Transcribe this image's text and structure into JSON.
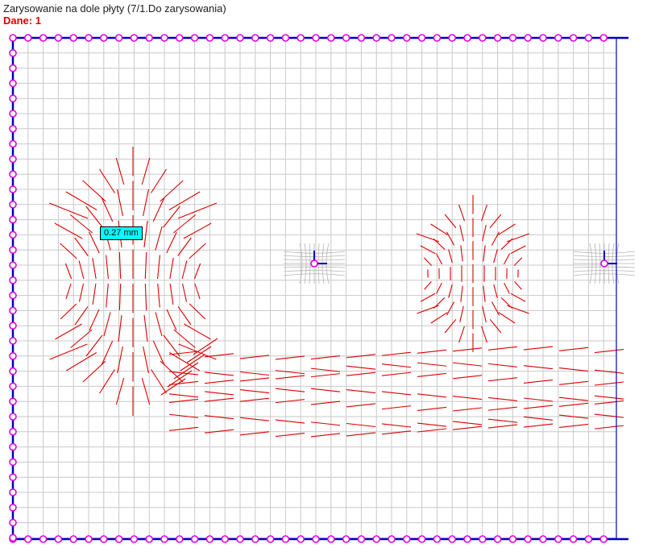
{
  "header": {
    "title": "Zarysowanie na dole płyty (7/1.Do zarysowania)",
    "subtitle": "Dane: 1"
  },
  "tooltip": {
    "value": "0.27 mm"
  },
  "colors": {
    "grid": "#c8c8c8",
    "border": "#0000c0",
    "support": "#e000e0",
    "crack": "#dd0000",
    "tooltip_bg": "#00ffff",
    "mesh": "#b4b4b4"
  }
}
